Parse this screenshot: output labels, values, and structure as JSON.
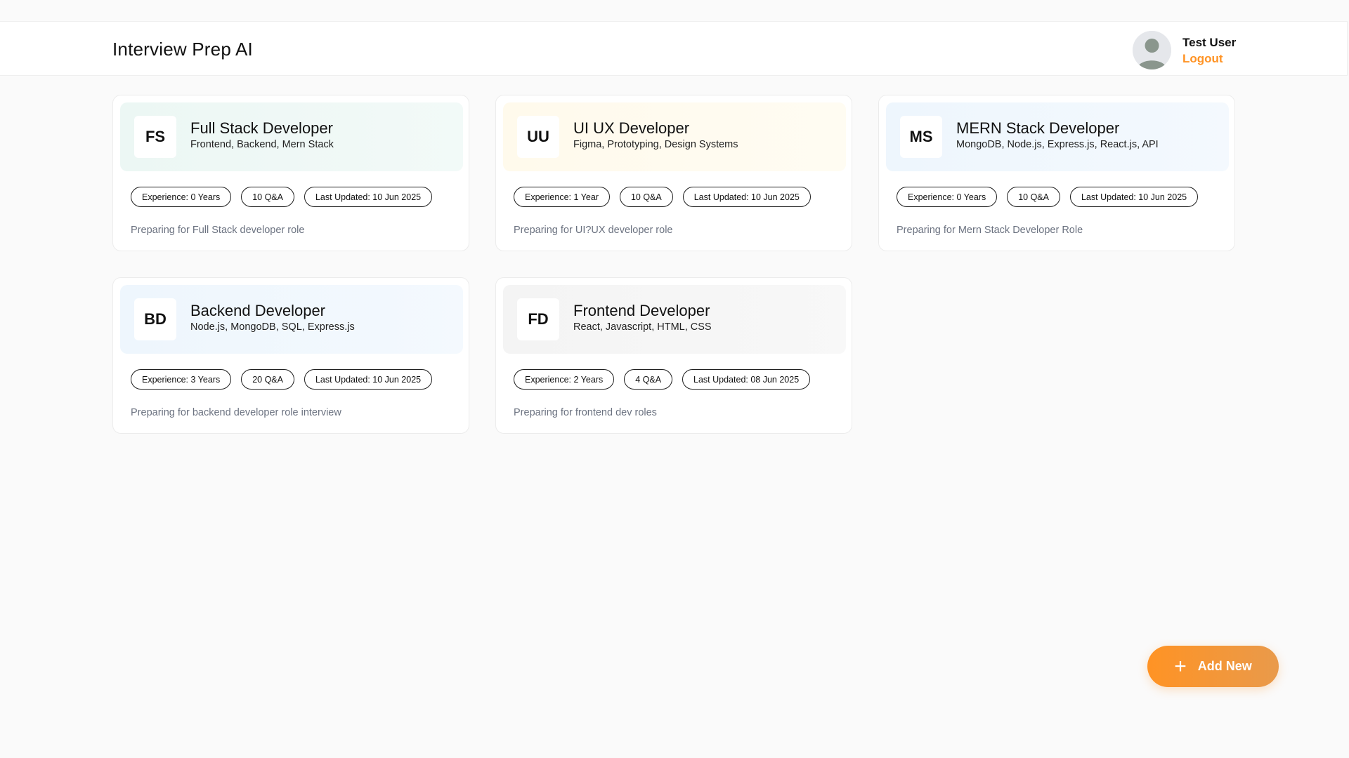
{
  "header": {
    "app_title": "Interview Prep AI",
    "user_name": "Test User",
    "logout_label": "Logout",
    "avatar_icon": "user-avatar-icon"
  },
  "sessions": [
    {
      "initials": "FS",
      "role": "Full Stack Developer",
      "topics": "Frontend, Backend, Mern Stack",
      "experience": "Experience: 0 Years",
      "questions": "10 Q&A",
      "updated": "Last Updated: 10 Jun 2025",
      "description": "Preparing for Full Stack developer role",
      "bg_color": "#ecf7f4"
    },
    {
      "initials": "UU",
      "role": "UI UX Developer",
      "topics": "Figma, Prototyping, Design Systems",
      "experience": "Experience: 1 Year",
      "questions": "10 Q&A",
      "updated": "Last Updated: 10 Jun 2025",
      "description": "Preparing for UI?UX developer role",
      "bg_color": "#fffaec"
    },
    {
      "initials": "MS",
      "role": "MERN Stack Developer",
      "topics": "MongoDB, Node.js, Express.js, React.js, API",
      "experience": "Experience: 0 Years",
      "questions": "10 Q&A",
      "updated": "Last Updated: 10 Jun 2025",
      "description": "Preparing for Mern Stack Developer Role",
      "bg_color": "#eef6fd"
    },
    {
      "initials": "BD",
      "role": "Backend Developer",
      "topics": "Node.js, MongoDB, SQL, Express.js",
      "experience": "Experience: 3 Years",
      "questions": "20 Q&A",
      "updated": "Last Updated: 10 Jun 2025",
      "description": "Preparing for backend developer role interview",
      "bg_color": "#eef6fd"
    },
    {
      "initials": "FD",
      "role": "Frontend Developer",
      "topics": "React, Javascript, HTML, CSS",
      "experience": "Experience: 2 Years",
      "questions": "4 Q&A",
      "updated": "Last Updated: 08 Jun 2025",
      "description": "Preparing for frontend dev roles",
      "bg_color": "#f4f4f4"
    }
  ],
  "add_button": {
    "label": "Add New",
    "icon": "plus-icon",
    "color": "#ff9324"
  }
}
